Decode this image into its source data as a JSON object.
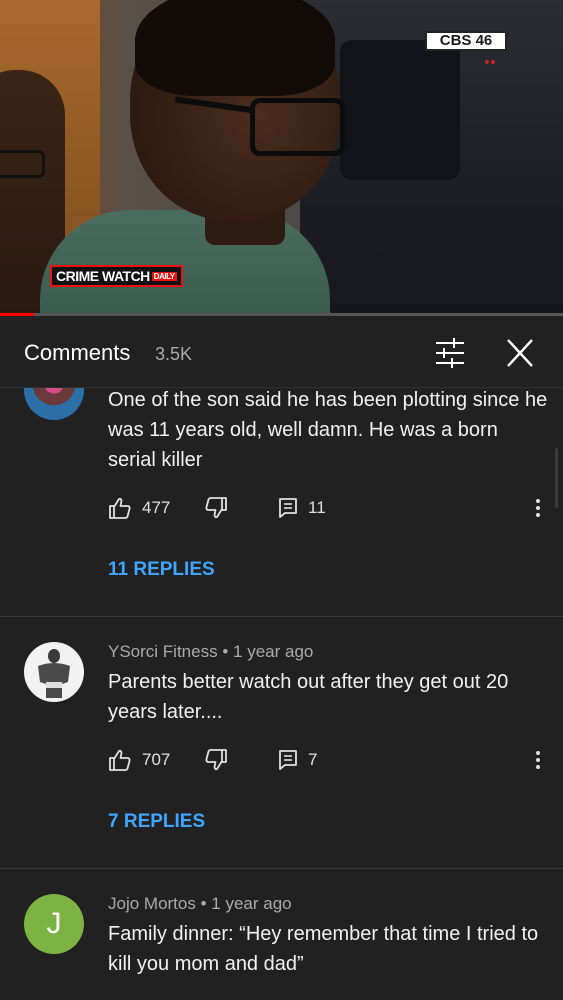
{
  "video": {
    "network_badge": "CBS 46",
    "show_badge": "CRIME WATCH",
    "show_badge_sub": "DAILY",
    "progress_fraction": 0.06
  },
  "panel": {
    "title": "Comments",
    "count": "3.5K",
    "filter_icon": "sliders-icon",
    "close_icon": "close-icon"
  },
  "comments": [
    {
      "author": "",
      "time": "",
      "text": "One of the son said he has been plotting since he was 11 years old, well damn. He was a born serial killer",
      "likes": "477",
      "reply_count": "11",
      "replies_label": "11 REPLIES"
    },
    {
      "author": "YSorci Fitness",
      "separator": "•",
      "time": "1 year ago",
      "text": "Parents better watch out after they get out 20 years later....",
      "likes": "707",
      "reply_count": "7",
      "replies_label": "7 REPLIES"
    },
    {
      "author": "Jojo Mortos",
      "separator": "•",
      "time": "1 year ago",
      "avatar_letter": "J",
      "avatar_color": "#7cb342",
      "text": "Family dinner: “Hey remember that time I tried to kill you mom and dad”"
    }
  ],
  "colors": {
    "background": "#212121",
    "link_blue": "#3ea6ff",
    "secondary_text": "#aaaaaa"
  }
}
